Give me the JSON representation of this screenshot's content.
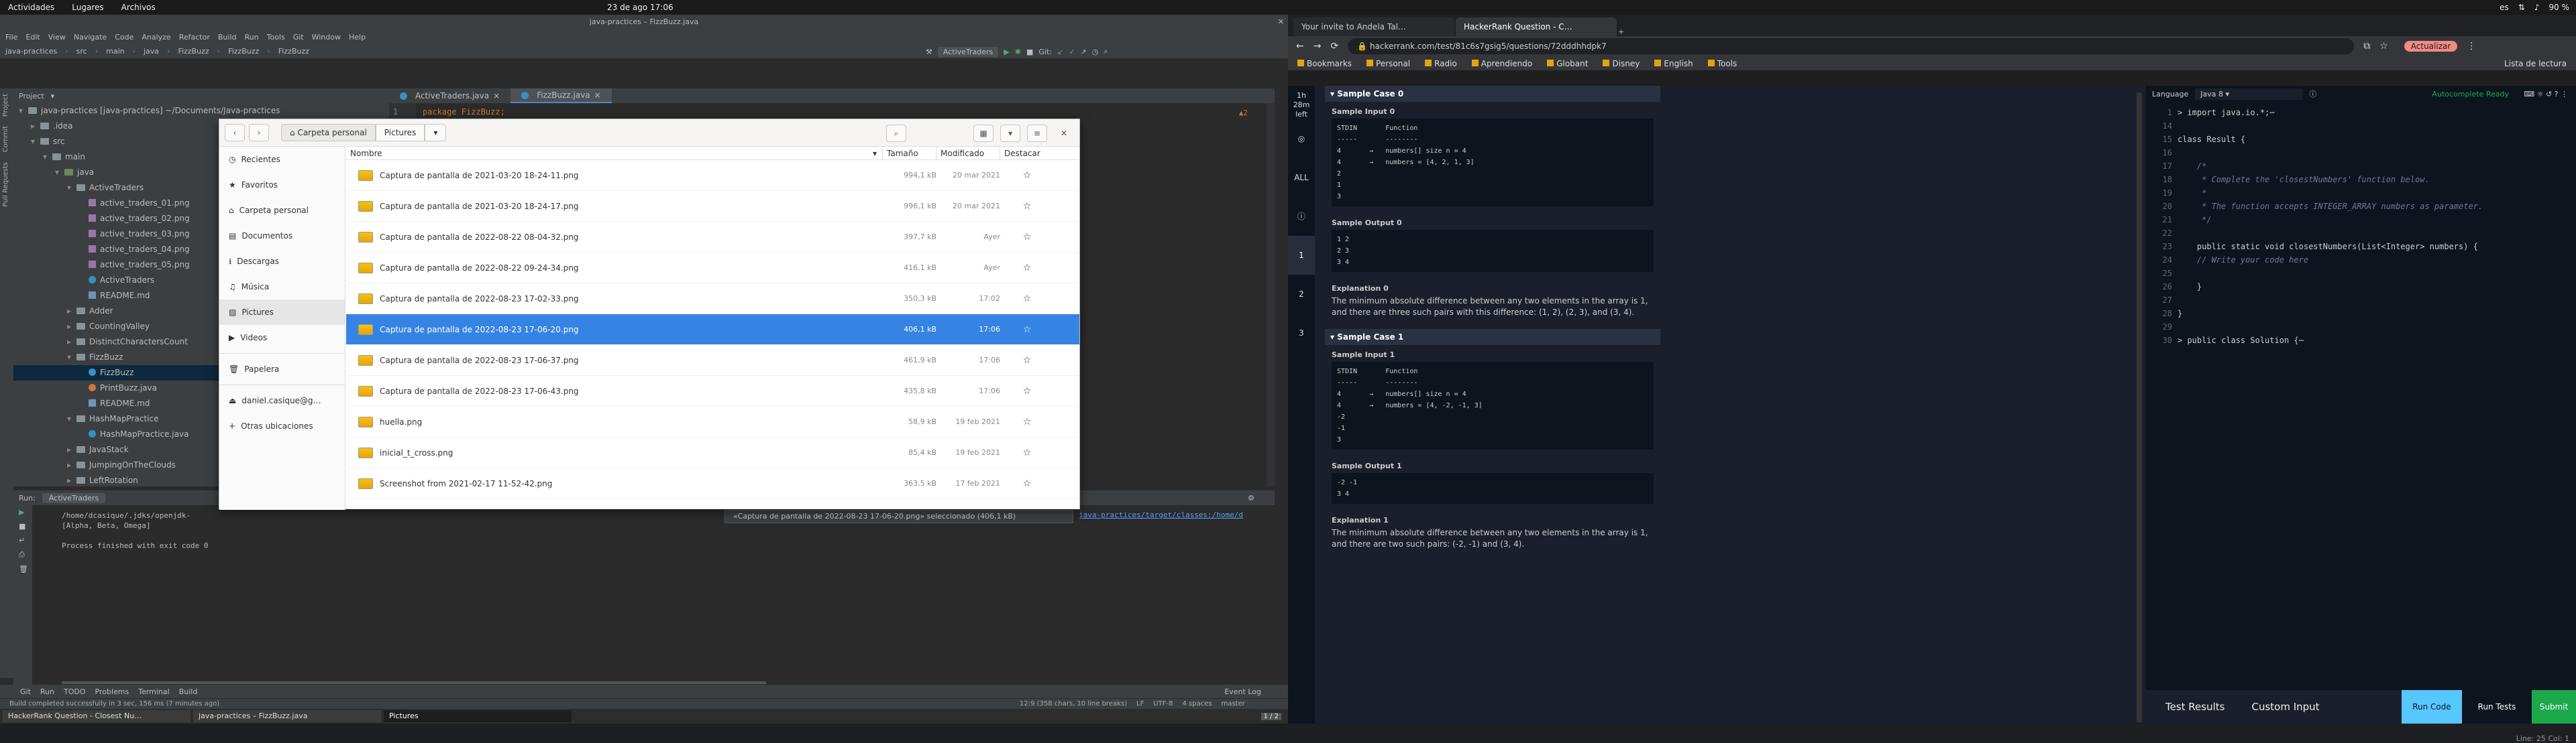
{
  "topbar": {
    "activities": "Actividades",
    "places": "Lugares",
    "files": "Archivos",
    "clock": "23 de ago  17:06",
    "lang": "es",
    "battery": "90 %"
  },
  "ide": {
    "title": "java-practices – FizzBuzz.java",
    "menu": [
      "File",
      "Edit",
      "View",
      "Navigate",
      "Code",
      "Analyze",
      "Refactor",
      "Build",
      "Run",
      "Tools",
      "Git",
      "Window",
      "Help"
    ],
    "breadcrumb": [
      "java-practices",
      "src",
      "main",
      "java",
      "FizzBuzz",
      "FizzBuzz",
      "FizzBuzz"
    ],
    "run_config": "ActiveTraders",
    "git_label": "Git:",
    "project_header": "Project",
    "tabs": [
      "ActiveTraders.java",
      "FizzBuzz.java"
    ],
    "tree": [
      {
        "label": "java-practices [java-practices] ~/Documents/Java-practices",
        "indent": 0,
        "icon": "folder",
        "arrow": "▾"
      },
      {
        "label": ".idea",
        "indent": 1,
        "icon": "folder",
        "arrow": "▸"
      },
      {
        "label": "src",
        "indent": 1,
        "icon": "folder",
        "arrow": "▾"
      },
      {
        "label": "main",
        "indent": 2,
        "icon": "folder",
        "arrow": "▾"
      },
      {
        "label": "java",
        "indent": 3,
        "icon": "src",
        "arrow": "▾"
      },
      {
        "label": "ActiveTraders",
        "indent": 4,
        "icon": "folder",
        "arrow": "▾"
      },
      {
        "label": "active_traders_01.png",
        "indent": 5,
        "icon": "img",
        "arrow": ""
      },
      {
        "label": "active_traders_02.png",
        "indent": 5,
        "icon": "img",
        "arrow": ""
      },
      {
        "label": "active_traders_03.png",
        "indent": 5,
        "icon": "img",
        "arrow": ""
      },
      {
        "label": "active_traders_04.png",
        "indent": 5,
        "icon": "img",
        "arrow": ""
      },
      {
        "label": "active_traders_05.png",
        "indent": 5,
        "icon": "img",
        "arrow": ""
      },
      {
        "label": "ActiveTraders",
        "indent": 5,
        "icon": "class",
        "arrow": ""
      },
      {
        "label": "README.md",
        "indent": 5,
        "icon": "md",
        "arrow": ""
      },
      {
        "label": "Adder",
        "indent": 4,
        "icon": "folder",
        "arrow": "▸"
      },
      {
        "label": "CountingValley",
        "indent": 4,
        "icon": "folder",
        "arrow": "▸"
      },
      {
        "label": "DistinctCharactersCount",
        "indent": 4,
        "icon": "folder",
        "arrow": "▸"
      },
      {
        "label": "FizzBuzz",
        "indent": 4,
        "icon": "folder",
        "arrow": "▾"
      },
      {
        "label": "FizzBuzz",
        "indent": 5,
        "icon": "class",
        "arrow": "",
        "selected": true
      },
      {
        "label": "PrintBuzz.java",
        "indent": 5,
        "icon": "java",
        "arrow": ""
      },
      {
        "label": "README.md",
        "indent": 5,
        "icon": "md",
        "arrow": ""
      },
      {
        "label": "HashMapPractice",
        "indent": 4,
        "icon": "folder",
        "arrow": "▾"
      },
      {
        "label": "HashMapPractice.java",
        "indent": 5,
        "icon": "class",
        "arrow": ""
      },
      {
        "label": "JavaStack",
        "indent": 4,
        "icon": "folder",
        "arrow": "▸"
      },
      {
        "label": "JumpingOnTheClouds",
        "indent": 4,
        "icon": "folder",
        "arrow": "▸"
      },
      {
        "label": "LeftRotation",
        "indent": 4,
        "icon": "folder",
        "arrow": "▸"
      }
    ],
    "code_line": "package FizzBuzz;",
    "warn": "▲2",
    "run": {
      "label": "Run:",
      "tab": "ActiveTraders",
      "out1": "/home/dcasique/.jdks/openjdk-",
      "out2": "[Alpha, Beta, Omega]",
      "out3": "Process finished with exit code 0",
      "link": "java-practices/target/classes:/home/d"
    },
    "bottom_tabs": [
      "Git",
      "Run",
      "TODO",
      "Problems",
      "Terminal",
      "Build"
    ],
    "event_log": "Event Log",
    "status_left": "Build completed successfully in 3 sec, 156 ms (7 minutes ago)",
    "status_right": [
      "12:9 (358 chars, 10 line breaks)",
      "LF",
      "UTF-8",
      "4 spaces",
      "master"
    ],
    "tooltip": "«Captura de pantalla de 2022-08-23 17-06-20.png» seleccionado (406,1 kB)"
  },
  "taskbar": {
    "items": [
      "HackerRank Question - Closest Nu…",
      "java-practices – FizzBuzz.java",
      "Pictures"
    ],
    "pager": "1 / 2"
  },
  "filedlg": {
    "path": [
      "Carpeta personal",
      "Pictures"
    ],
    "sidebar": [
      "Recientes",
      "Favoritos",
      "Carpeta personal",
      "Documentos",
      "Descargas",
      "Música",
      "Pictures",
      "Videos",
      "Papelera",
      "daniel.casique@g…",
      "Otras ubicaciones"
    ],
    "cols": {
      "name": "Nombre",
      "size": "Tamaño",
      "modified": "Modificado",
      "star": "Destacar"
    },
    "files": [
      {
        "name": "Captura de pantalla de 2021-03-20 18-24-11.png",
        "size": "994,1 kB",
        "mod": "20 mar 2021"
      },
      {
        "name": "Captura de pantalla de 2021-03-20 18-24-17.png",
        "size": "996,1 kB",
        "mod": "20 mar 2021"
      },
      {
        "name": "Captura de pantalla de 2022-08-22 08-04-32.png",
        "size": "397,7 kB",
        "mod": "Ayer"
      },
      {
        "name": "Captura de pantalla de 2022-08-22 09-24-34.png",
        "size": "416,1 kB",
        "mod": "Ayer"
      },
      {
        "name": "Captura de pantalla de 2022-08-23 17-02-33.png",
        "size": "350,3 kB",
        "mod": "17:02"
      },
      {
        "name": "Captura de pantalla de 2022-08-23 17-06-20.png",
        "size": "406,1 kB",
        "mod": "17:06",
        "selected": true
      },
      {
        "name": "Captura de pantalla de 2022-08-23 17-06-37.png",
        "size": "461,9 kB",
        "mod": "17:06"
      },
      {
        "name": "Captura de pantalla de 2022-08-23 17-06-43.png",
        "size": "435,8 kB",
        "mod": "17:06"
      },
      {
        "name": "huella.png",
        "size": "58,9 kB",
        "mod": "19 feb 2021"
      },
      {
        "name": "inicial_t_cross.png",
        "size": "85,4 kB",
        "mod": "19 feb 2021"
      },
      {
        "name": "Screenshot from 2021-02-17 11-52-42.png",
        "size": "363,5 kB",
        "mod": "17 feb 2021"
      }
    ]
  },
  "chrome": {
    "tabs": [
      "Your invite to Andela Tal…",
      "HackerRank Question - C…"
    ],
    "url": "hackerrank.com/test/81c6s7gsig5/questions/72dddhhdpk7",
    "update": "Actualizar",
    "bookmarks": [
      "Bookmarks",
      "Personal",
      "Radio",
      "Aprendiendo",
      "Globant",
      "Disney",
      "English",
      "Tools"
    ],
    "reading": "Lista de lectura"
  },
  "hr": {
    "timer": "1h 28m left",
    "all": "ALL",
    "questions": [
      "1",
      "2",
      "3"
    ],
    "case0": {
      "head": "Sample Case 0",
      "in_title": "Sample Input 0",
      "in": "STDIN       Function\n-----       --------\n4       →   numbers[] size n = 4\n4       →   numbers = [4, 2, 1, 3]\n2\n1\n3",
      "out_title": "Sample Output 0",
      "out": "1 2\n2 3\n3 4",
      "exp_title": "Explanation 0",
      "exp": "The minimum absolute difference between any two elements in the array is 1, and there are three such pairs with this difference: (1, 2), (2, 3), and (3, 4)."
    },
    "case1": {
      "head": "Sample Case 1",
      "in_title": "Sample Input 1",
      "in": "STDIN       Function\n-----       --------\n4       →   numbers[] size n = 4\n4       →   numbers = [4, -2, -1, 3]\n-2\n-1\n3",
      "out_title": "Sample Output 1",
      "out": "-2 -1\n3 4",
      "exp_title": "Explanation 1",
      "exp": "The minimum absolute difference between any two elements in the array is 1, and there are two such pairs: (-2, -1) and (3, 4)."
    },
    "language_label": "Language",
    "language": "Java 8",
    "autosave": "Autocomplete Ready",
    "code": [
      {
        "n": "1",
        "t": "> import java.io.*;⋯"
      },
      {
        "n": "14",
        "t": ""
      },
      {
        "n": "15",
        "t": "class Result {"
      },
      {
        "n": "16",
        "t": ""
      },
      {
        "n": "17",
        "t": "    /*"
      },
      {
        "n": "18",
        "t": "     * Complete the 'closestNumbers' function below."
      },
      {
        "n": "19",
        "t": "     *"
      },
      {
        "n": "20",
        "t": "     * The function accepts INTEGER_ARRAY numbers as parameter."
      },
      {
        "n": "21",
        "t": "     */"
      },
      {
        "n": "22",
        "t": ""
      },
      {
        "n": "23",
        "t": "    public static void closestNumbers(List<Integer> numbers) {"
      },
      {
        "n": "24",
        "t": "    // Write your code here"
      },
      {
        "n": "25",
        "t": ""
      },
      {
        "n": "26",
        "t": "    }"
      },
      {
        "n": "27",
        "t": ""
      },
      {
        "n": "28",
        "t": "}"
      },
      {
        "n": "29",
        "t": ""
      },
      {
        "n": "30",
        "t": "> public class Solution {⋯"
      }
    ],
    "linecol": "Line: 25 Col: 1",
    "test_results": "Test Results",
    "custom_input": "Custom Input",
    "run_code": "Run Code",
    "run_tests": "Run Tests",
    "submit": "Submit"
  }
}
